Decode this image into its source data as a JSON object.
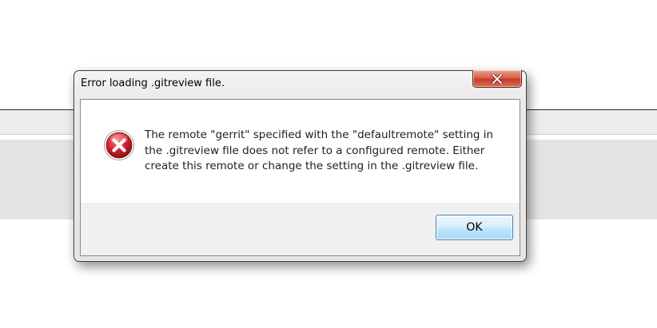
{
  "dialog": {
    "title": "Error loading .gitreview file.",
    "close_icon": "close-icon",
    "message_icon": "error-icon",
    "message_lines": [
      "The remote \"gerrit\" specified with the \"defaultremote\" setting in",
      "the .gitreview file does not refer to a configured remote. Either",
      "create this remote or change the setting in the .gitreview file."
    ],
    "ok_label": "OK"
  },
  "colors": {
    "close_button": "#c8432c",
    "error_icon": "#c8202c",
    "ok_button_border": "#3c7fb1"
  }
}
